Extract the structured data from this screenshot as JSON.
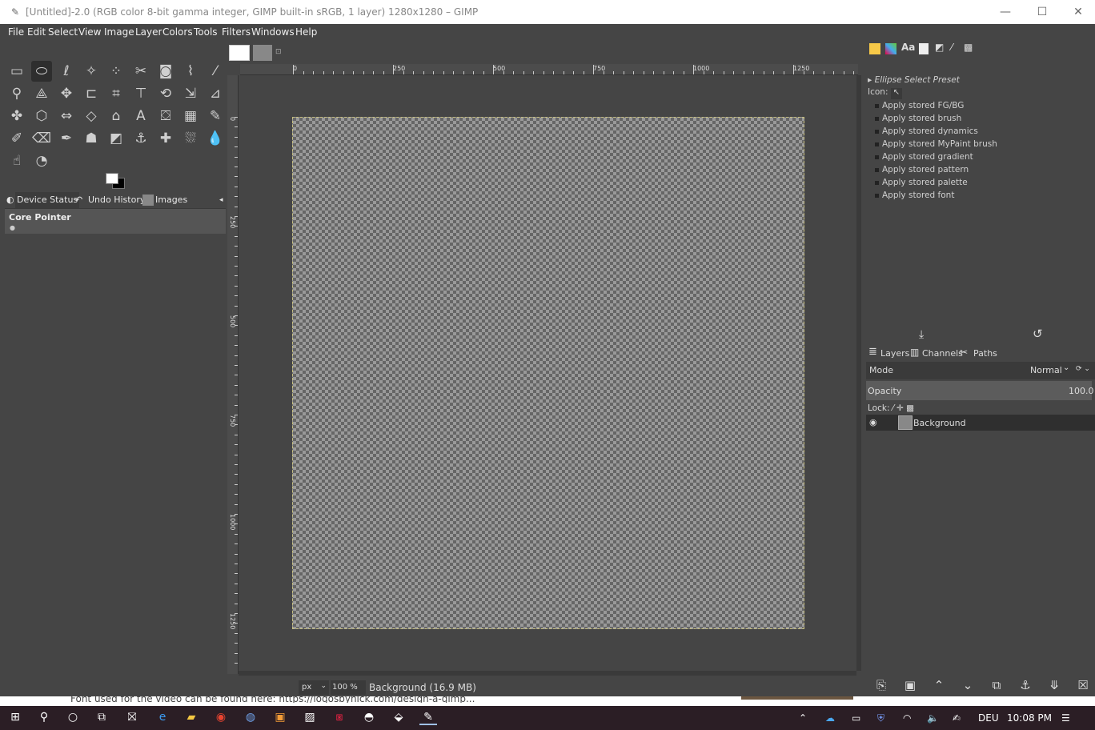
{
  "window": {
    "title": "[Untitled]-2.0 (RGB color 8-bit gamma integer, GIMP built-in sRGB, 1 layer) 1280x1280 – GIMP",
    "minimize_glyph": "—",
    "maximize_glyph": "☐",
    "close_glyph": "✕"
  },
  "menu": [
    "File",
    "Edit",
    "Select",
    "View",
    "Image",
    "Layer",
    "Colors",
    "Tools",
    "Filters",
    "Windows",
    "Help"
  ],
  "tools": [
    "rect-select-icon",
    "ellipse-select-icon",
    "free-select-icon",
    "fuzzy-select-icon",
    "select-by-color-icon",
    "scissors-icon",
    "foreground-select-icon",
    "paths-icon",
    "color-picker-icon",
    "zoom-icon",
    "measure-icon",
    "move-icon",
    "align-icon",
    "crop-icon",
    "unified-transform-icon",
    "rotate-icon",
    "scale-icon",
    "shear-icon",
    "warp-icon",
    "handle-transform-icon",
    "cage-icon",
    "flip-icon",
    "perspective-icon",
    "text-icon",
    "bucket-fill-icon",
    "gradient-icon",
    "pencil-icon",
    "paintbrush-icon",
    "eraser-icon",
    "airbrush-icon",
    "ink-icon",
    "mypaint-brush-icon",
    "clone-icon",
    "perspective-clone-icon",
    "heal-icon",
    "smudge-icon",
    "blur-icon",
    "dodge-burn-icon"
  ],
  "dock_tabs": {
    "device_status": "Device Status",
    "undo_history": "Undo History",
    "images": "Images"
  },
  "device_status": {
    "core_pointer": "Core Pointer"
  },
  "rulers": {
    "h": [
      "0",
      "250",
      "500",
      "750",
      "1000",
      "1250"
    ],
    "v": [
      "0",
      "250",
      "500",
      "750",
      "1000",
      "1250"
    ]
  },
  "status": {
    "unit": "px",
    "zoom": "100 %",
    "info": "Background (16.9 MB)"
  },
  "presets": {
    "title": "Ellipse Select Preset",
    "icon_label": "Icon:",
    "items": [
      "Apply stored FG/BG",
      "Apply stored brush",
      "Apply stored dynamics",
      "Apply stored MyPaint brush",
      "Apply stored gradient",
      "Apply stored pattern",
      "Apply stored palette",
      "Apply stored font"
    ]
  },
  "layers": {
    "tabs": [
      "Layers",
      "Channels",
      "Paths"
    ],
    "mode_label": "Mode",
    "mode_value": "Normal",
    "opacity_label": "Opacity",
    "opacity_value": "100.0",
    "lock_label": "Lock:",
    "layer_name": "Background"
  },
  "behind_text": "Font used for the video can be found here: https://logosbynick.com/design-a-gimp...",
  "tray": {
    "language": "DEU",
    "time": "10:08 PM"
  }
}
